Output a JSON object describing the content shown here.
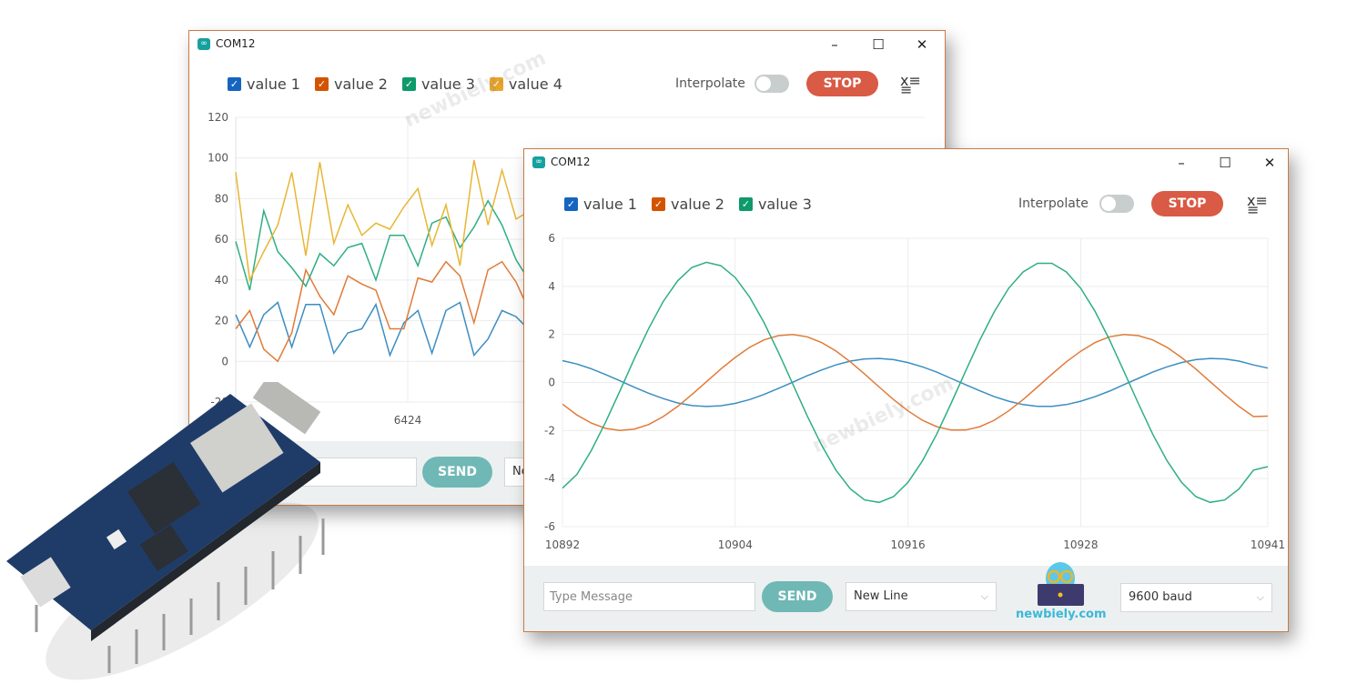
{
  "back_window": {
    "title": "COM12",
    "controls": {
      "minimize": "–",
      "maximize": "☐",
      "close": "✕"
    },
    "legend": [
      "value 1",
      "value 2",
      "value 3",
      "value 4"
    ],
    "interpolate_label": "Interpolate",
    "interpolate_on": false,
    "stop_label": "STOP",
    "send_label": "SEND",
    "line_ending_partial": "Ne",
    "watermark": "newbiely.com"
  },
  "front_window": {
    "title": "COM12",
    "controls": {
      "minimize": "–",
      "maximize": "☐",
      "close": "✕"
    },
    "legend": [
      "value 1",
      "value 2",
      "value 3"
    ],
    "interpolate_label": "Interpolate",
    "interpolate_on": false,
    "stop_label": "STOP",
    "message_placeholder": "Type Message",
    "send_label": "SEND",
    "line_ending": "New Line",
    "baud": "9600 baud",
    "logo_text": "newbiely.com",
    "watermark": "newbiely.com"
  },
  "colors": {
    "value1": "#3b8ec2",
    "value2": "#e07b39",
    "value3": "#2fae85",
    "value4": "#e8b634",
    "checkbox1": "#1565c0",
    "checkbox2": "#d35400",
    "checkbox3": "#0e9a6a",
    "checkbox4": "#e8a52a",
    "stop": "#d95a45",
    "send": "#6fb8b5",
    "window_border": "#c97a45"
  },
  "icons": {
    "app": "arduino-infinity-icon",
    "clear": "clear-list-icon",
    "dropdown": "chevron-down-icon"
  },
  "chart_data": [
    {
      "type": "line",
      "ylim": [
        -20,
        120
      ],
      "y_ticks": [
        "120",
        "100",
        "80",
        "60",
        "40",
        "20",
        "0",
        "-20"
      ],
      "x_ticks": [
        "6424"
      ],
      "grid": true,
      "legend": "top-left",
      "series": [
        {
          "name": "value 1",
          "values": [
            23,
            7,
            23,
            29,
            7,
            28,
            28,
            4,
            14,
            16,
            28,
            3,
            19,
            25,
            4,
            25,
            29,
            3,
            11,
            25,
            22,
            15
          ]
        },
        {
          "name": "value 2",
          "values": [
            16,
            25,
            6,
            0,
            14,
            45,
            32,
            23,
            42,
            38,
            35,
            16,
            16,
            41,
            39,
            49,
            42,
            19,
            45,
            49,
            39,
            24
          ]
        },
        {
          "name": "value 3",
          "values": [
            59,
            35,
            74,
            54,
            46,
            37,
            53,
            47,
            56,
            58,
            40,
            62,
            62,
            47,
            68,
            71,
            56,
            66,
            79,
            67,
            50,
            39
          ]
        },
        {
          "name": "value 4",
          "values": [
            93,
            40,
            54,
            67,
            93,
            52,
            98,
            58,
            77,
            62,
            68,
            65,
            76,
            85,
            57,
            77,
            47,
            99,
            67,
            94,
            70,
            74
          ]
        }
      ]
    },
    {
      "type": "line",
      "xlim": [
        10892,
        10941
      ],
      "ylim": [
        -6,
        6
      ],
      "x_start": 10892,
      "x_ticks": [
        "10892",
        "10904",
        "10916",
        "10928",
        "10941"
      ],
      "y_ticks": [
        "6",
        "4",
        "2",
        "0",
        "-2",
        "-4",
        "-6"
      ],
      "grid": true,
      "legend": "top-left",
      "series": [
        {
          "name": "value 1",
          "values": [
            0.91,
            0.77,
            0.57,
            0.33,
            0.07,
            -0.2,
            -0.45,
            -0.67,
            -0.85,
            -0.96,
            -1,
            -0.97,
            -0.87,
            -0.71,
            -0.5,
            -0.25,
            0.01,
            0.28,
            0.52,
            0.73,
            0.89,
            0.98,
            1,
            0.95,
            0.83,
            0.65,
            0.43,
            0.17,
            -0.09,
            -0.35,
            -0.59,
            -0.78,
            -0.92,
            -0.99,
            -0.99,
            -0.92,
            -0.78,
            -0.59,
            -0.36,
            -0.09,
            0.17,
            0.43,
            0.65,
            0.83,
            0.95,
            1,
            0.98,
            0.89,
            0.73,
            0.6
          ]
        },
        {
          "name": "value 2",
          "values": [
            -0.9,
            -1.35,
            -1.69,
            -1.91,
            -2,
            -1.94,
            -1.75,
            -1.42,
            -1,
            -0.5,
            0.03,
            0.56,
            1.04,
            1.46,
            1.77,
            1.95,
            2,
            1.9,
            1.66,
            1.31,
            0.86,
            0.35,
            -0.19,
            -0.71,
            -1.18,
            -1.57,
            -1.84,
            -1.98,
            -1.98,
            -1.84,
            -1.57,
            -1.18,
            -0.71,
            -0.19,
            0.35,
            0.86,
            1.3,
            1.66,
            1.9,
            2,
            1.95,
            1.77,
            1.46,
            1.04,
            0.56,
            0.03,
            -0.5,
            -1,
            -1.42,
            -1.4
          ]
        },
        {
          "name": "value 3",
          "values": [
            -4.4,
            -3.83,
            -2.84,
            -1.65,
            -0.34,
            1,
            2.26,
            3.37,
            4.23,
            4.79,
            5,
            4.86,
            4.37,
            3.56,
            2.5,
            1.26,
            -0.07,
            -1.39,
            -2.61,
            -3.65,
            -4.43,
            -4.89,
            -4.99,
            -4.75,
            -4.16,
            -3.27,
            -2.15,
            -0.87,
            0.47,
            1.77,
            2.95,
            3.92,
            4.6,
            4.96,
            4.96,
            4.6,
            3.92,
            2.96,
            1.78,
            0.47,
            -0.87,
            -2.15,
            -3.26,
            -4.15,
            -4.75,
            -4.99,
            -4.89,
            -4.43,
            -3.65,
            -3.5
          ]
        }
      ]
    }
  ]
}
